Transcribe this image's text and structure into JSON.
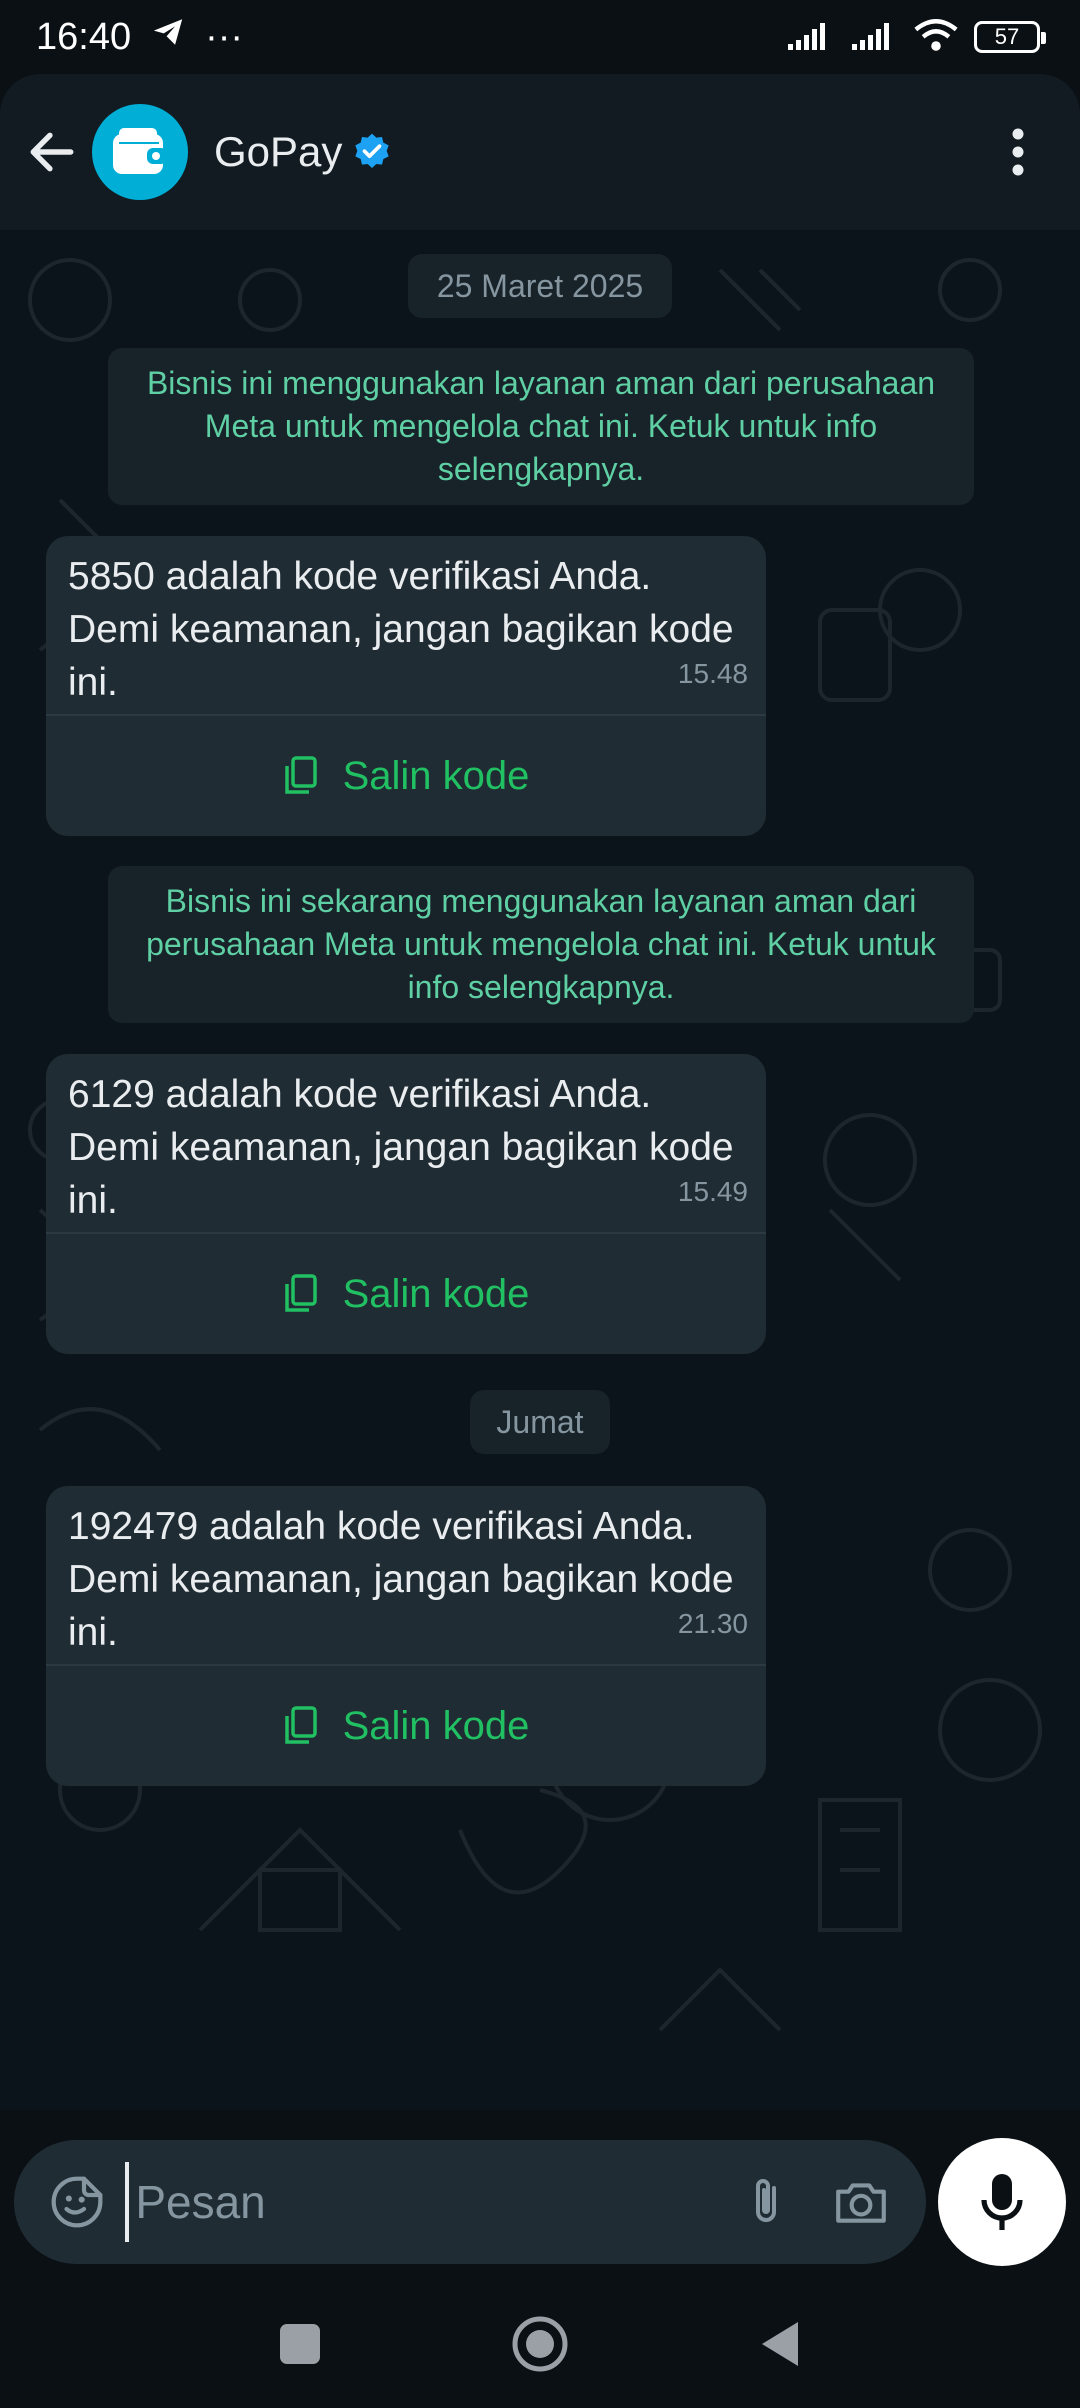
{
  "status_bar": {
    "time": "16:40",
    "more_indicator": "···",
    "battery_level": "57",
    "icons": [
      "telegram-icon",
      "signal-icon",
      "signal-icon",
      "wifi-icon",
      "battery-icon"
    ]
  },
  "header": {
    "contact_name": "GoPay",
    "verified": true,
    "icons": [
      "back-arrow-icon",
      "wallet-icon",
      "verified-badge-icon",
      "more-vertical-icon"
    ]
  },
  "chat": {
    "date_1": "25 Maret 2025",
    "notice_1": "Bisnis ini menggunakan layanan aman dari perusahaan Meta untuk mengelola chat ini. Ketuk untuk info selengkapnya.",
    "messages": [
      {
        "code": "5850",
        "text": " adalah kode verifikasi Anda. Demi keamanan, jangan bagikan kode ini.",
        "time": "15.48",
        "copy_label": "Salin kode"
      },
      {
        "code": "6129",
        "text": " adalah kode verifikasi Anda. Demi keamanan, jangan bagikan kode ini.",
        "time": "15.49",
        "copy_label": "Salin kode"
      },
      {
        "code": "192479",
        "text": " adalah kode verifikasi Anda. Demi keamanan, jangan bagikan kode ini.",
        "time": "21.30",
        "copy_label": "Salin kode"
      }
    ],
    "notice_2": "Bisnis ini sekarang menggunakan layanan aman dari perusahaan Meta untuk mengelola chat ini. Ketuk untuk info selengkapnya.",
    "date_2": "Jumat"
  },
  "input": {
    "placeholder": "Pesan",
    "icons": [
      "sticker-icon",
      "paperclip-icon",
      "camera-icon",
      "microphone-icon"
    ]
  },
  "colors": {
    "accent_green": "#21c063",
    "notice_green": "#5fcfa4",
    "bubble_bg": "#202c33",
    "header_bg": "#111b21"
  }
}
